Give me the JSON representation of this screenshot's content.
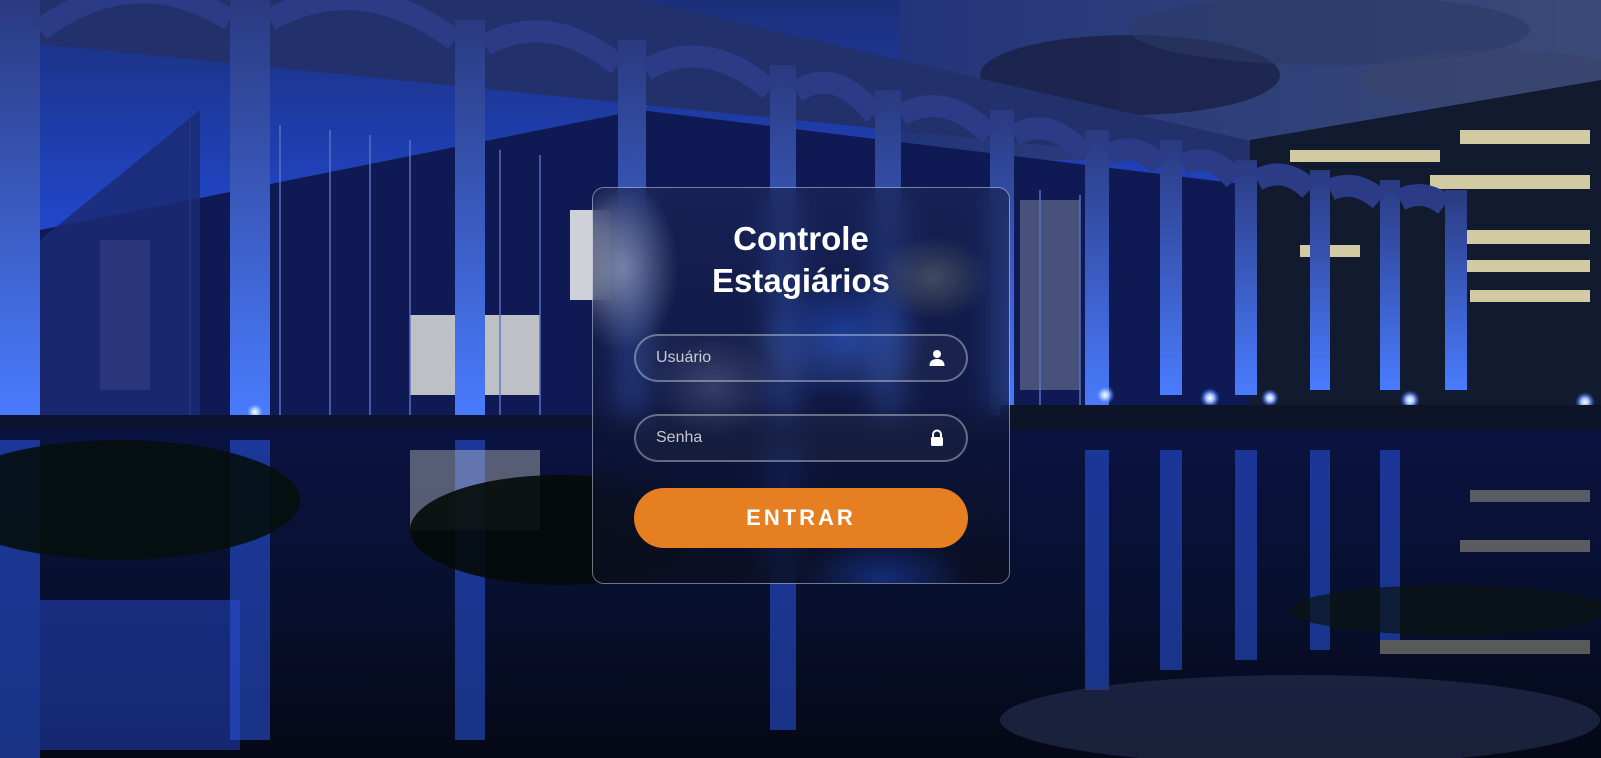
{
  "login": {
    "title_line1": "Controle",
    "title_line2": "Estagiários",
    "username": {
      "placeholder": "Usuário",
      "value": "",
      "icon": "user-icon"
    },
    "password": {
      "placeholder": "Senha",
      "value": "",
      "icon": "lock-icon"
    },
    "submit_label": "ENTRAR"
  },
  "colors": {
    "accent": "#e67e22",
    "text": "#ffffff",
    "night_sky": "#0d1e5c",
    "arch_glow": "#2f5ee0"
  }
}
